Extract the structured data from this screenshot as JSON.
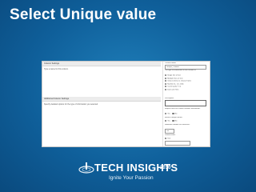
{
  "slide": {
    "title": "Select Unique value"
  },
  "form": {
    "section1": {
      "heading": "Column Settings",
      "description": "Type a name for this column."
    },
    "section2": {
      "heading": "Additional Column Settings",
      "description": "Specify detailed options for the type of information you selected."
    },
    "right": {
      "column_name_label": "Column name:",
      "column_name_value": "Unique_Column",
      "type_label": "The type of information in this column is:",
      "types": [
        {
          "label": "Single line of text",
          "selected": false
        },
        {
          "label": "Multiple lines of text",
          "selected": false
        },
        {
          "label": "Choice (menu to choose from)",
          "selected": true
        },
        {
          "label": "Number (1, 1.0, 100)",
          "selected": false
        },
        {
          "label": "Currency ($, ¥, €)",
          "selected": false
        },
        {
          "label": "Date and Time",
          "selected": false
        }
      ],
      "description_label": "Description:",
      "required_label": "Require that this column contains information:",
      "yes": "Yes",
      "no": "No",
      "unique_label": "Enforce unique values:",
      "max_label": "Maximum number of characters:",
      "max_value": "255",
      "default_label": "Default value:",
      "default_option": "Text"
    }
  },
  "logo": {
    "brand": "TECH INSIGHTS",
    "year": "2010",
    "tagline": "Ignite Your Passion"
  }
}
